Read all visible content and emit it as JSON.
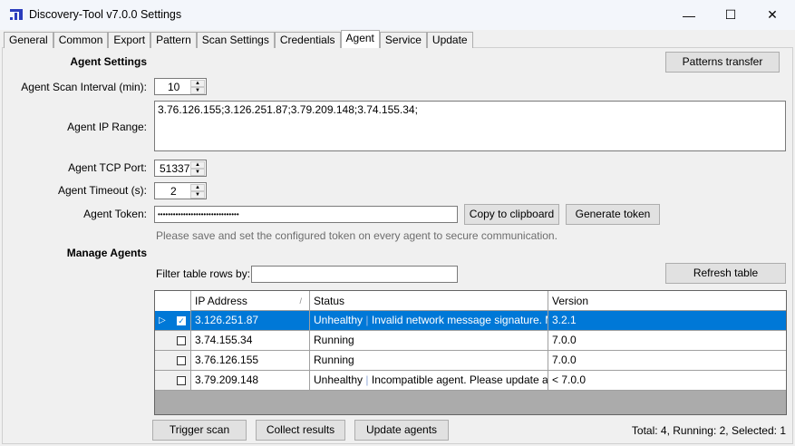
{
  "window": {
    "title": "Discovery-Tool v7.0.0 Settings",
    "minimize": "—",
    "maximize": "☐",
    "close": "✕"
  },
  "tabs": [
    "General",
    "Common",
    "Export",
    "Pattern",
    "Scan Settings",
    "Credentials",
    "Agent",
    "Service",
    "Update"
  ],
  "active_tab": "Agent",
  "agent_settings": {
    "heading": "Agent Settings",
    "patterns_transfer": "Patterns transfer",
    "scan_interval_label": "Agent Scan Interval (min):",
    "scan_interval": "10",
    "ip_range_label": "Agent IP Range:",
    "ip_range": "3.76.126.155;3.126.251.87;3.79.209.148;3.74.155.34;",
    "tcp_port_label": "Agent TCP Port:",
    "tcp_port": "51337",
    "timeout_label": "Agent Timeout (s):",
    "timeout": "2",
    "token_label": "Agent Token:",
    "token": "••••••••••••••••••••••••••••••••",
    "copy_clipboard": "Copy to clipboard",
    "generate_token": "Generate token",
    "hint": "Please save and set the configured token on every agent to secure communication."
  },
  "manage_agents": {
    "heading": "Manage Agents",
    "filter_label": "Filter table rows by:",
    "filter_value": "",
    "refresh": "Refresh table",
    "columns": [
      "IP Address",
      "Status",
      "Version"
    ],
    "rows": [
      {
        "checked": true,
        "selected": true,
        "ip": "3.126.251.87",
        "state": "Unhealthy",
        "detail": "Invalid network message signature. Mes...",
        "version": "3.2.1"
      },
      {
        "checked": false,
        "selected": false,
        "ip": "3.74.155.34",
        "state": "Running",
        "detail": "",
        "version": "7.0.0"
      },
      {
        "checked": false,
        "selected": false,
        "ip": "3.76.126.155",
        "state": "Running",
        "detail": "",
        "version": "7.0.0"
      },
      {
        "checked": false,
        "selected": false,
        "ip": "3.79.209.148",
        "state": "Unhealthy",
        "detail": "Incompatible agent. Please update age...",
        "version": "< 7.0.0"
      }
    ],
    "trigger_scan": "Trigger scan",
    "collect_results": "Collect results",
    "update_agents": "Update agents",
    "summary": "Total: 4, Running: 2, Selected: 1"
  }
}
